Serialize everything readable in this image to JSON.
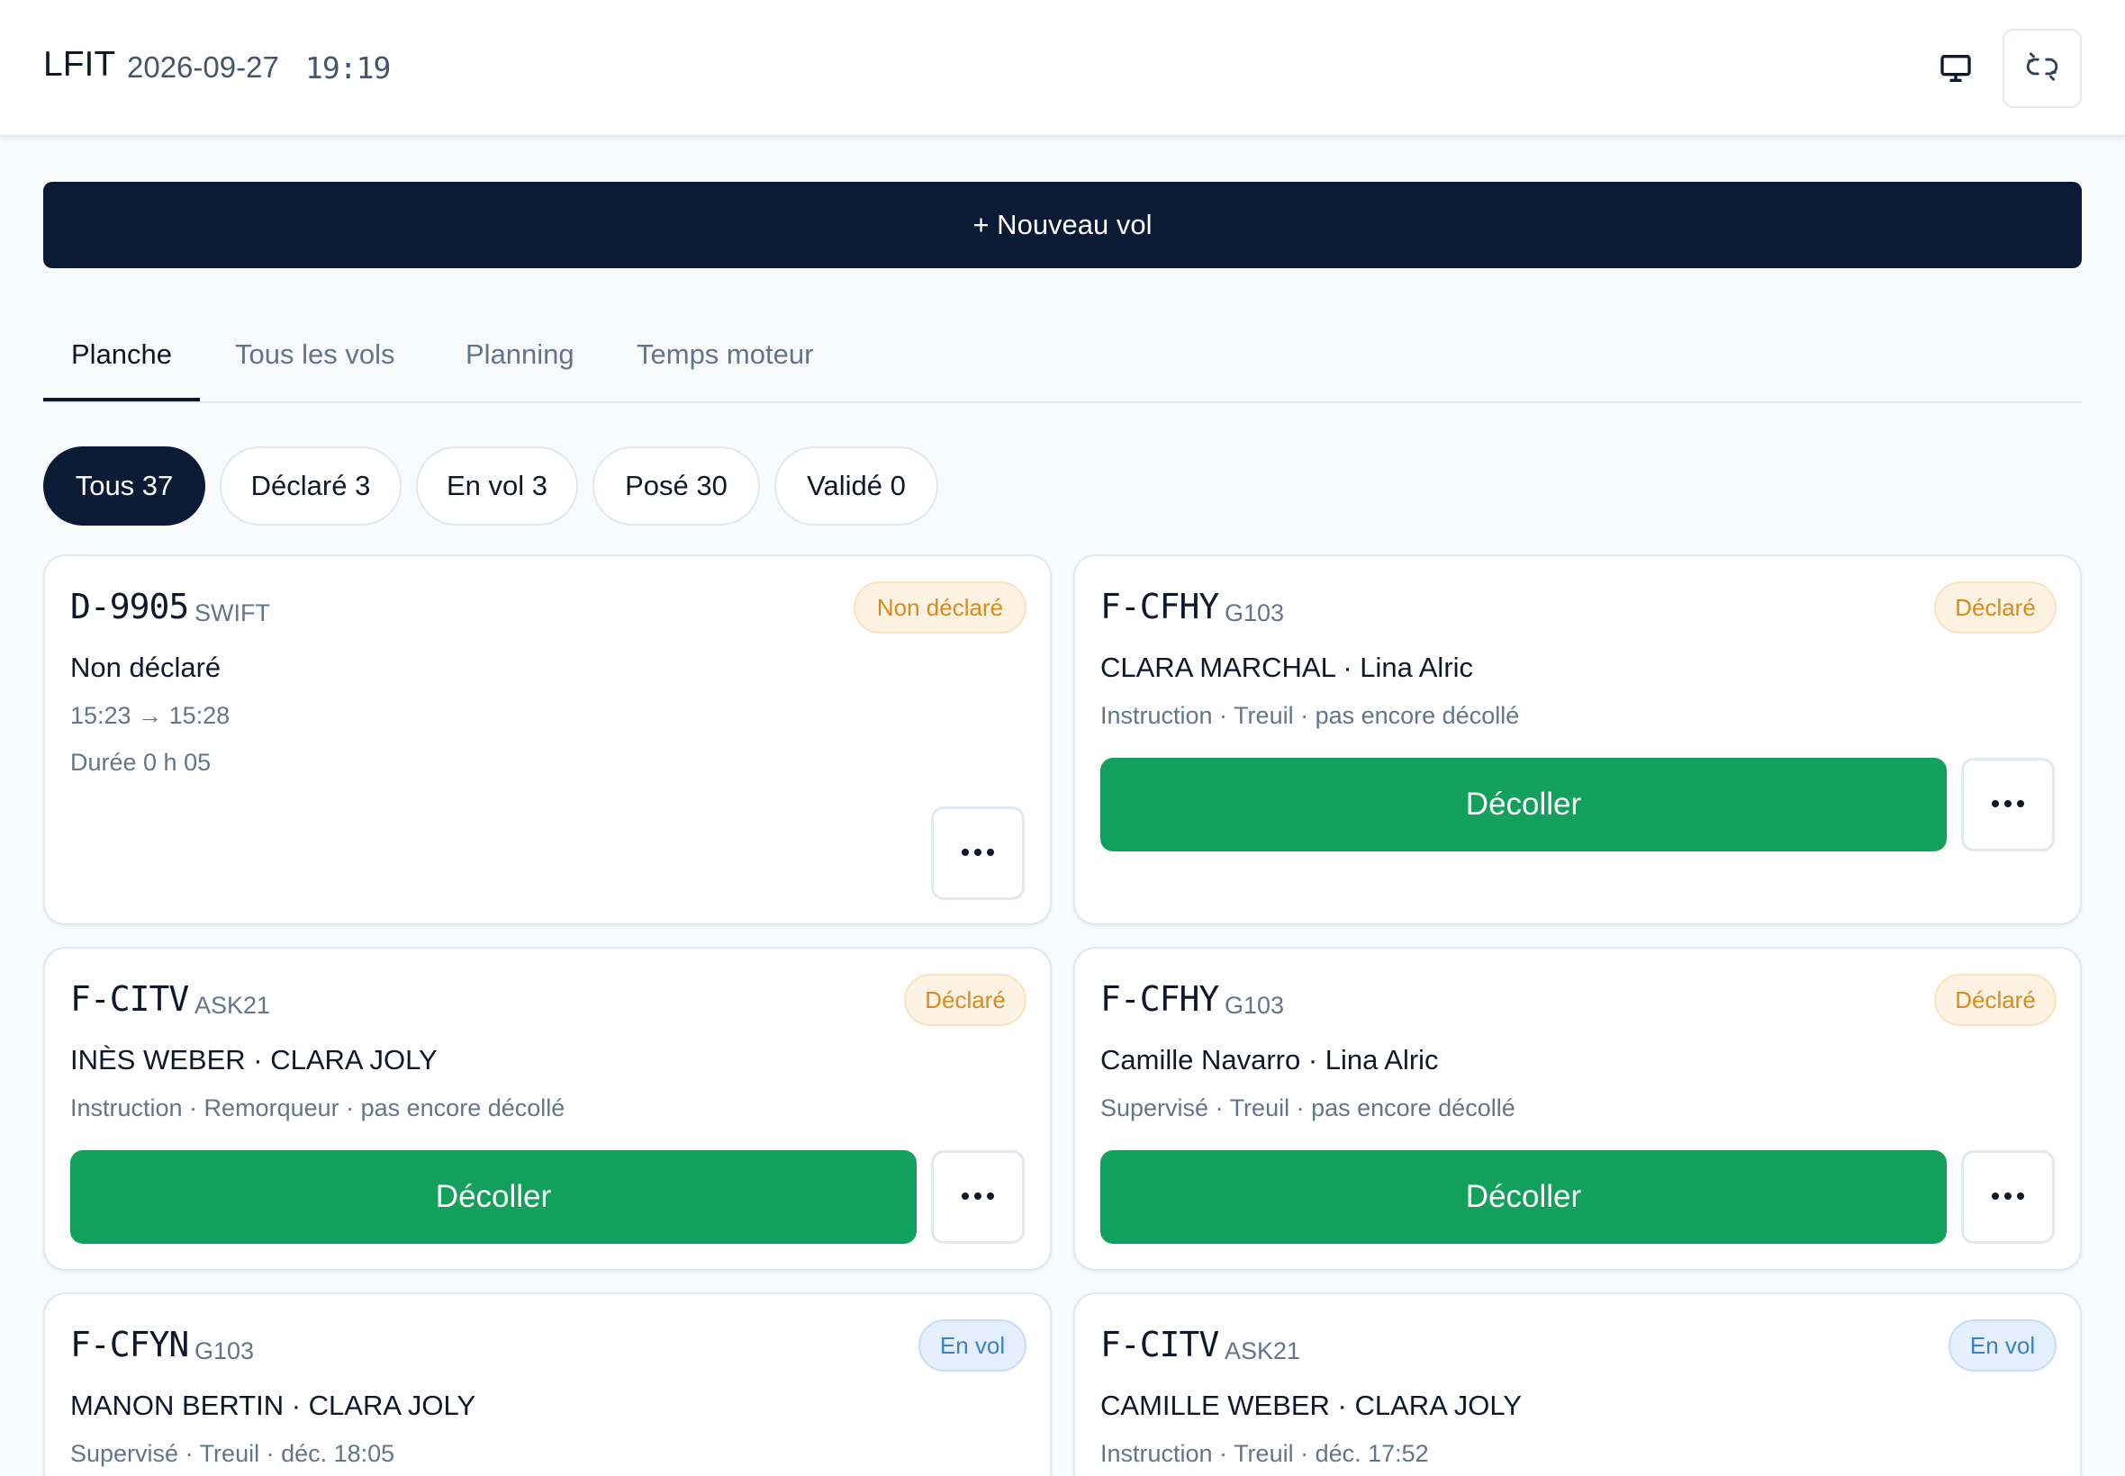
{
  "header": {
    "airfield": "LFIT",
    "date": "2026-09-27",
    "time": "19:19",
    "icons": [
      "monitor-icon",
      "unlink-icon"
    ]
  },
  "new_flight_label": "+ Nouveau vol",
  "tabs": [
    {
      "label": "Planche",
      "active": true
    },
    {
      "label": "Tous les vols",
      "active": false
    },
    {
      "label": "Planning",
      "active": false
    },
    {
      "label": "Temps moteur",
      "active": false
    }
  ],
  "filters": [
    {
      "label": "Tous 37",
      "active": true
    },
    {
      "label": "Déclaré 3",
      "active": false
    },
    {
      "label": "En vol 3",
      "active": false
    },
    {
      "label": "Posé 30",
      "active": false
    },
    {
      "label": "Validé 0",
      "active": false
    }
  ],
  "flights": [
    {
      "registration": "D-9905",
      "type": "SWIFT",
      "status": "Non déclaré",
      "crew": "Non déclaré",
      "times": "15:23 → 15:28",
      "duration": "Durée 0 h 05"
    },
    {
      "registration": "F-CFHY",
      "type": "G103",
      "status": "Déclaré",
      "crew": "CLARA MARCHAL · Lina Alric",
      "details": "Instruction · Treuil · pas encore décollé",
      "action": "Décoller"
    },
    {
      "registration": "F-CITV",
      "type": "ASK21",
      "status": "Déclaré",
      "crew": "INÈS WEBER · CLARA JOLY",
      "details": "Instruction · Remorqueur · pas encore décollé",
      "action": "Décoller"
    },
    {
      "registration": "F-CFHY",
      "type": "G103",
      "status": "Déclaré",
      "crew": "Camille Navarro · Lina Alric",
      "details": "Supervisé · Treuil · pas encore décollé",
      "action": "Décoller"
    },
    {
      "registration": "F-CFYN",
      "type": "G103",
      "status": "En vol",
      "crew": "MANON BERTIN · CLARA JOLY",
      "details": "Supervisé · Treuil · déc. 18:05"
    },
    {
      "registration": "F-CITV",
      "type": "ASK21",
      "status": "En vol",
      "crew": "CAMILLE WEBER · CLARA JOLY",
      "details": "Instruction · Treuil · déc. 17:52"
    }
  ],
  "colors": {
    "navy": "#0b1a35",
    "green": "#12a05c",
    "amber": "#d98a1c",
    "blue": "#3b82c4"
  }
}
